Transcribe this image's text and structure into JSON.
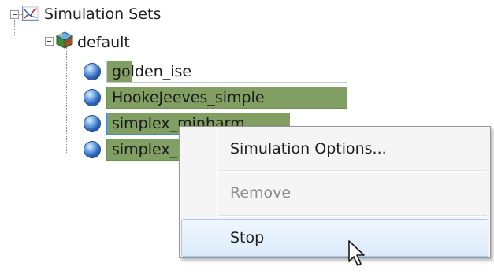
{
  "tree": {
    "root_label": "Simulation Sets",
    "group_label": "default",
    "items": [
      {
        "label": "golden_ise"
      },
      {
        "label": "HookeJeeves_simple"
      },
      {
        "label": "simplex_minharm"
      },
      {
        "label": "simplex_"
      }
    ]
  },
  "context_menu": {
    "items": [
      {
        "label": "Simulation Options...",
        "enabled": true
      },
      {
        "label": "Remove",
        "enabled": false
      },
      {
        "label": "Stop",
        "enabled": true,
        "highlighted": true
      }
    ]
  },
  "icons": {
    "root": "simulation-sets-icon",
    "group": "cube-group-icon",
    "item": "blue-sphere-icon",
    "cursor": "mouse-pointer-icon"
  },
  "colors": {
    "selection_fill": "#819f62",
    "selection_border": "#6f8c52",
    "focus_border": "#4a8ad6",
    "menu_hover_border": "#a8c8ef"
  }
}
